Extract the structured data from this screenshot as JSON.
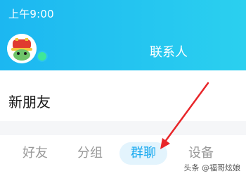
{
  "status_bar": {
    "time": "上午9:00"
  },
  "header": {
    "title": "联系人"
  },
  "list": {
    "new_friends_label": "新朋友"
  },
  "tabs": [
    {
      "label": "好友",
      "active": false
    },
    {
      "label": "分组",
      "active": false
    },
    {
      "label": "群聊",
      "active": true
    },
    {
      "label": "设备",
      "active": false
    }
  ],
  "watermark": "头条 @福哥炫娘",
  "colors": {
    "header_start": "#1cb7f1",
    "header_end": "#2bd0ef",
    "active_tab_text": "#18a9ef",
    "active_tab_bg": "#e3f4fd",
    "inactive_tab_text": "#999999",
    "annotation_arrow": "#e8262a",
    "online_dot": "#3ee79a"
  }
}
